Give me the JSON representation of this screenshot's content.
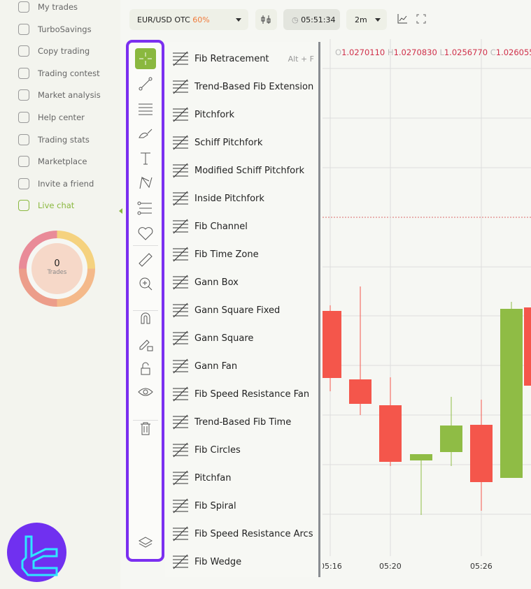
{
  "sidebar": {
    "items": [
      {
        "label": "My trades",
        "icon": "trades-icon"
      },
      {
        "label": "TurboSavings",
        "icon": "turbo-icon"
      },
      {
        "label": "Copy trading",
        "icon": "copy-icon"
      },
      {
        "label": "Trading contest",
        "icon": "contest-icon"
      },
      {
        "label": "Market analysis",
        "icon": "pie-icon"
      },
      {
        "label": "Help center",
        "icon": "info-icon"
      },
      {
        "label": "Trading stats",
        "icon": "bar-chart-icon"
      },
      {
        "label": "Marketplace",
        "icon": "gear-icon"
      },
      {
        "label": "Invite a friend",
        "icon": "users-icon"
      },
      {
        "label": "Live chat",
        "icon": "chat-icon",
        "active": true
      }
    ],
    "trades_count": "0",
    "trades_label": "Trades"
  },
  "topbar": {
    "pair": "EUR/USD OTC",
    "payout": "60%",
    "timer": "05:51:34",
    "timeframe": "2m"
  },
  "toolbar": {
    "tools": [
      "crosshair",
      "trend-line",
      "fib",
      "brush",
      "text",
      "pattern",
      "prediction",
      "favorites",
      "ruler",
      "zoom-in",
      "magnet",
      "lock-drawing",
      "unlock",
      "hide",
      "delete",
      "layers"
    ]
  },
  "menu": {
    "items": [
      {
        "label": "Fib Retracement",
        "shortcut": "Alt + F"
      },
      {
        "label": "Trend-Based Fib Extension"
      },
      {
        "label": "Pitchfork"
      },
      {
        "label": "Schiff Pitchfork"
      },
      {
        "label": "Modified Schiff Pitchfork"
      },
      {
        "label": "Inside Pitchfork"
      },
      {
        "label": "Fib Channel"
      },
      {
        "label": "Fib Time Zone"
      },
      {
        "label": "Gann Box"
      },
      {
        "label": "Gann Square Fixed"
      },
      {
        "label": "Gann Square"
      },
      {
        "label": "Gann Fan"
      },
      {
        "label": "Fib Speed Resistance Fan"
      },
      {
        "label": "Trend-Based Fib Time"
      },
      {
        "label": "Fib Circles"
      },
      {
        "label": "Pitchfan"
      },
      {
        "label": "Fib Spiral"
      },
      {
        "label": "Fib Speed Resistance Arcs"
      },
      {
        "label": "Fib Wedge"
      }
    ]
  },
  "chart": {
    "ohlc": {
      "o_label": "O",
      "o": "1.0270110",
      "h_label": "H",
      "h": "1.0270830",
      "l_label": "L",
      "l": "1.0256770",
      "c_label": "C",
      "c": "1.026055"
    },
    "x_labels": [
      "05:16",
      "05:20",
      "05:26"
    ],
    "candles": [
      "down",
      "down",
      "down",
      "up",
      "up",
      "down",
      "up",
      "down"
    ],
    "colors": {
      "up": "#8fbc45",
      "down": "#f4564b"
    }
  },
  "colors": {
    "accent": "#8ab83f",
    "highlight": "#7b2ff0"
  }
}
